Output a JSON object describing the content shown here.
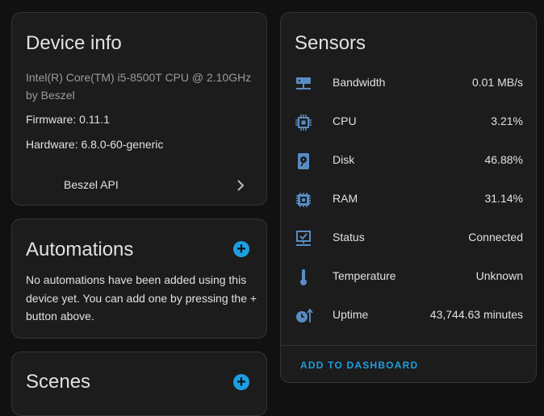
{
  "device_info": {
    "title": "Device info",
    "model": "Intel(R) Core(TM) i5-8500T CPU @ 2.10GHz",
    "manufacturer": "by Beszel",
    "firmware": "Firmware: 0.11.1",
    "hardware": "Hardware: 6.8.0-60-generic",
    "link_label": "Beszel API"
  },
  "automations": {
    "title": "Automations",
    "description_line1": "No automations have been added using this",
    "description_line2": "device yet. You can add one by pressing the +",
    "description_line3": "button above."
  },
  "scenes": {
    "title": "Scenes"
  },
  "sensors": {
    "title": "Sensors",
    "items": [
      {
        "name": "Bandwidth",
        "value": "0.01 MB/s",
        "icon": "server-network-icon"
      },
      {
        "name": "CPU",
        "value": "3.21%",
        "icon": "cpu-icon"
      },
      {
        "name": "Disk",
        "value": "46.88%",
        "icon": "harddisk-icon"
      },
      {
        "name": "RAM",
        "value": "31.14%",
        "icon": "memory-icon"
      },
      {
        "name": "Status",
        "value": "Connected",
        "icon": "monitor-check-icon"
      },
      {
        "name": "Temperature",
        "value": "Unknown",
        "icon": "thermometer-icon"
      },
      {
        "name": "Uptime",
        "value": "43,744.63 minutes",
        "icon": "clock-arrow-icon"
      }
    ],
    "action_label": "ADD TO DASHBOARD"
  },
  "colors": {
    "accent": "#1e9ee0",
    "icon": "#5a8cc4",
    "background": "#111111",
    "card": "#1c1c1c"
  }
}
